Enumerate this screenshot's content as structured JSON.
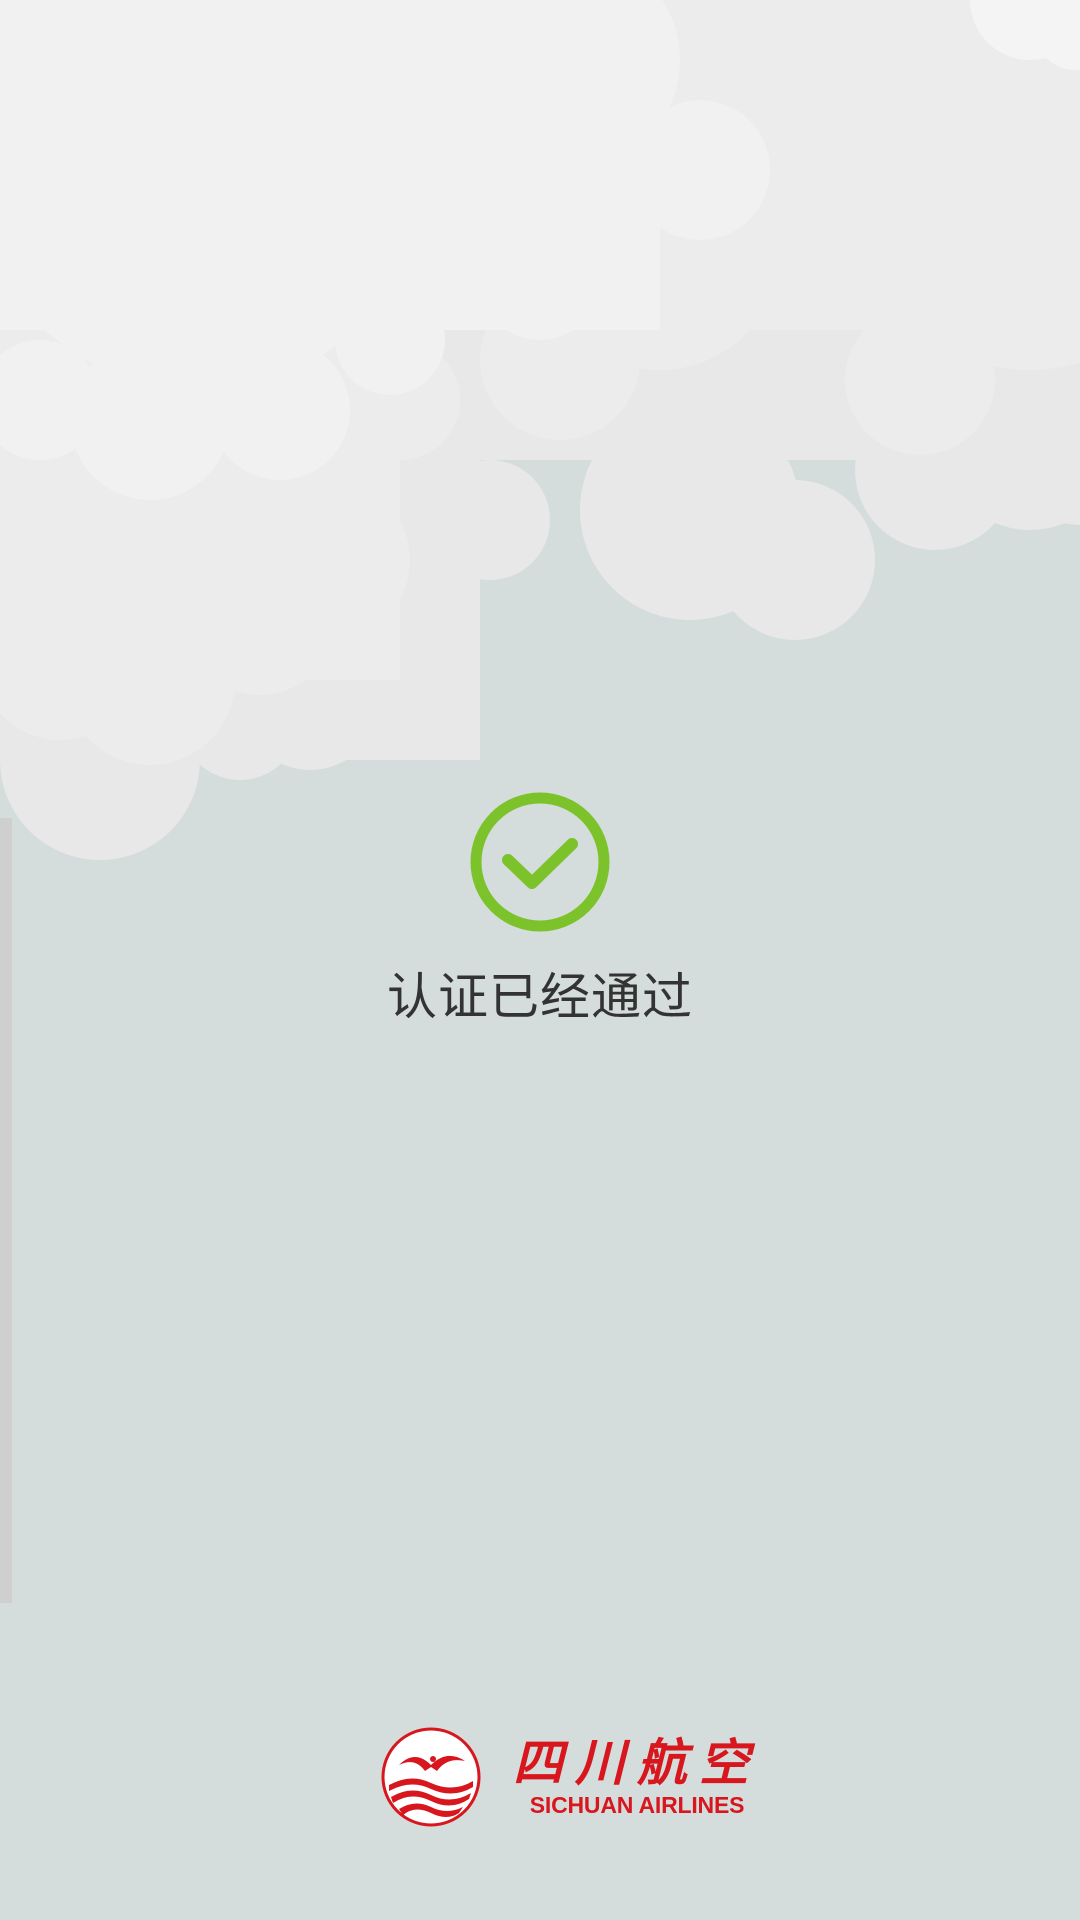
{
  "status": {
    "icon": "check-circle-icon",
    "message": "认证已经通过",
    "color": "#7cc22b"
  },
  "brand": {
    "name_cn": "四川航空",
    "name_en": "SICHUAN AIRLINES",
    "color": "#d7161e",
    "logo": "sichuan-airlines-logo"
  },
  "background": "#d4dddb"
}
